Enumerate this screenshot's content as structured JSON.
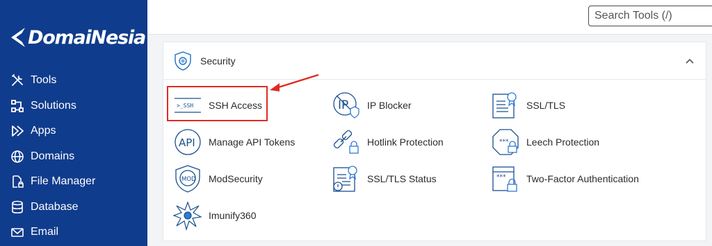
{
  "brand": {
    "name": "DomaiNesia"
  },
  "sidebar": {
    "items": [
      {
        "label": "Tools",
        "icon": "tools-icon"
      },
      {
        "label": "Solutions",
        "icon": "solutions-icon"
      },
      {
        "label": "Apps",
        "icon": "apps-icon"
      },
      {
        "label": "Domains",
        "icon": "globe-icon"
      },
      {
        "label": "File Manager",
        "icon": "folder-icon"
      },
      {
        "label": "Database",
        "icon": "database-icon"
      },
      {
        "label": "Email",
        "icon": "email-icon"
      }
    ]
  },
  "search": {
    "placeholder": "Search Tools (/)"
  },
  "section": {
    "title": "Security",
    "tools": [
      {
        "label": "SSH Access",
        "icon": "ssh-icon"
      },
      {
        "label": "IP Blocker",
        "icon": "ip-blocker-icon"
      },
      {
        "label": "SSL/TLS",
        "icon": "ssl-certificate-icon"
      },
      {
        "label": "Manage API Tokens",
        "icon": "api-icon"
      },
      {
        "label": "Hotlink Protection",
        "icon": "hotlink-icon"
      },
      {
        "label": "Leech Protection",
        "icon": "leech-icon"
      },
      {
        "label": "ModSecurity",
        "icon": "modsecurity-icon"
      },
      {
        "label": "SSL/TLS Status",
        "icon": "ssl-status-icon"
      },
      {
        "label": "Two-Factor Authentication",
        "icon": "two-factor-icon"
      },
      {
        "label": "Imunify360",
        "icon": "imunify-icon"
      }
    ]
  },
  "colors": {
    "sidebar": "#103c8d",
    "accent": "#1a6fc9",
    "annotation": "#e02a24"
  }
}
